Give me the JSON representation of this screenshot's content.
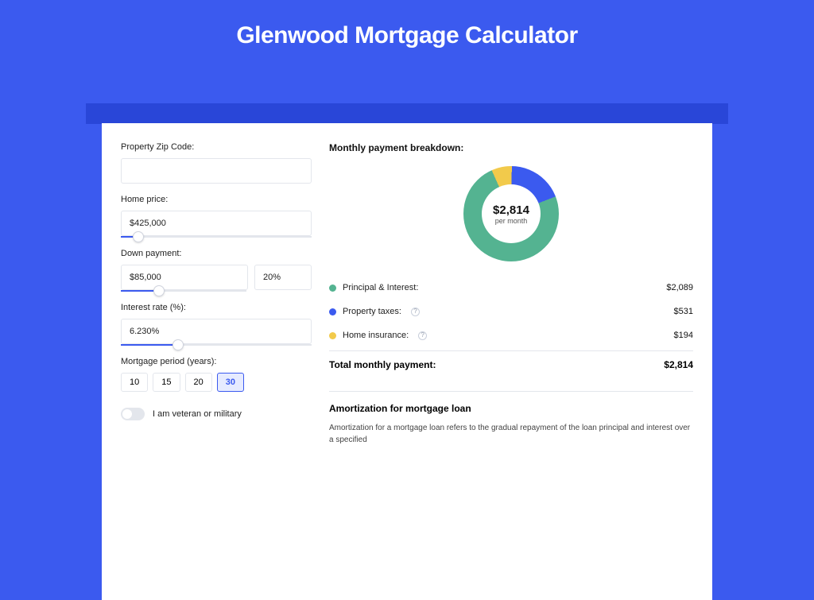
{
  "page_title": "Glenwood Mortgage Calculator",
  "form": {
    "zip_label": "Property Zip Code:",
    "zip_value": "",
    "home_price_label": "Home price:",
    "home_price_value": "$425,000",
    "home_price_slider_pct": 9,
    "down_payment_label": "Down payment:",
    "down_payment_value": "$85,000",
    "down_payment_pct_value": "20%",
    "down_payment_slider_pct": 20,
    "interest_label": "Interest rate (%):",
    "interest_value": "6.230%",
    "interest_slider_pct": 30,
    "period_label": "Mortgage period (years):",
    "periods": [
      "10",
      "15",
      "20",
      "30"
    ],
    "period_active_index": 3,
    "veteran_label": "I am veteran or military"
  },
  "breakdown": {
    "title": "Monthly payment breakdown:",
    "total_amount": "$2,814",
    "per_month_label": "per month",
    "items": [
      {
        "label": "Principal & Interest:",
        "amount": "$2,089",
        "color": "#54b391",
        "has_info": false
      },
      {
        "label": "Property taxes:",
        "amount": "$531",
        "color": "#3b5aef",
        "has_info": true
      },
      {
        "label": "Home insurance:",
        "amount": "$194",
        "color": "#f2ca4b",
        "has_info": true
      }
    ],
    "total_label": "Total monthly payment:",
    "total_value": "$2,814"
  },
  "chart_data": {
    "type": "pie",
    "title": "Monthly payment breakdown",
    "series": [
      {
        "name": "Principal & Interest",
        "value": 2089,
        "color": "#54b391"
      },
      {
        "name": "Property taxes",
        "value": 531,
        "color": "#3b5aef"
      },
      {
        "name": "Home insurance",
        "value": 194,
        "color": "#f2ca4b"
      }
    ],
    "total": 2814,
    "center_label": "$2,814 per month"
  },
  "amort": {
    "title": "Amortization for mortgage loan",
    "text": "Amortization for a mortgage loan refers to the gradual repayment of the loan principal and interest over a specified"
  }
}
